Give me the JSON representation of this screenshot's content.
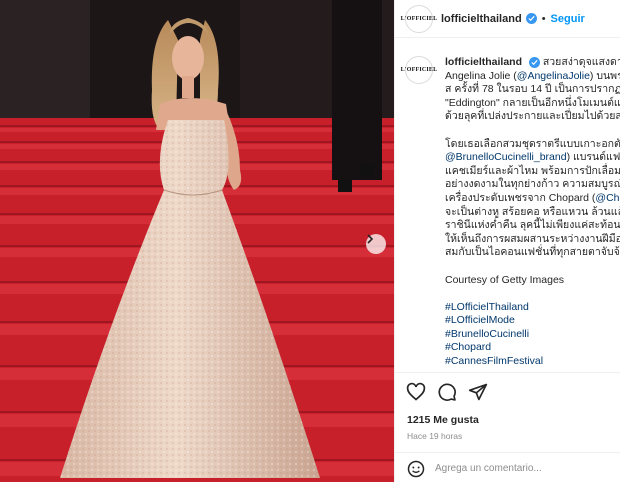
{
  "account": {
    "username": "lofficielthailand",
    "avatar_text": "L'OFFICIEL",
    "verified": true,
    "follow_label": "Seguir",
    "separator": "•"
  },
  "caption": {
    "username": "lofficielthailand",
    "lines": [
      "สวยสง่าดุจแสงดาว ::",
      "Angelina Jolie (",
      "@AngelinaJolie",
      ") บนพร",
      "ส ครั้งที่ 78 ในรอบ 14 ปี เป็นการปรากฏตั",
      "\"Eddington\" กลายเป็นอีกหนึ่งโมเมนต์แห",
      "ด้วยลุคที่เปล่งประกายและเปี่ยมไปด้วยสเ"
    ],
    "para2": [
      "โดยเธอเลือกสวมชุดราตรีแบบเกาะอกตัดเ",
      "@BrunelloCucinelli_brand",
      ") แบรนด์แฟช",
      "แคชเมียร์และผ้าไหม พร้อมการปักเลื่อมอ",
      "อย่างงดงามในทุกย่างก้าว ความสมบูรณ์แบ",
      "เครื่องประดับเพชรจาก Chopard (",
      "@Chop",
      "จะเป็นต่างหู สร้อยคอ หรือแหวน ล้วนแล้ว",
      "ราชินีแห่งค่ำคืน ลุคนี้ไม่เพียงแค่สะท้อนคุ",
      "ให้เห็นถึงการผสมผสานระหว่างงานฝีมือชั้",
      "สมกับเป็นไอคอนแฟชั่นที่ทุกสายตาจับจ้อ"
    ],
    "courtesy": "Courtesy of Getty Images",
    "hashtags": [
      "#LOfficielThailand",
      "#LOfficielMode",
      "#BrunelloCucinelli",
      "#Chopard",
      "#CannesFilmFestival"
    ]
  },
  "actions": {
    "like_icon": "heart-icon",
    "comment_icon": "comment-icon",
    "share_icon": "share-icon"
  },
  "likes_text": "1215 Me gusta",
  "time_text": "Hace 19 horas",
  "comment": {
    "emoji_icon": "emoji-icon",
    "placeholder": "Agrega un comentario..."
  },
  "colors": {
    "accent": "#0095f6",
    "verified": "#3897f0",
    "link": "#00376b",
    "carpet": "#c8202b"
  }
}
